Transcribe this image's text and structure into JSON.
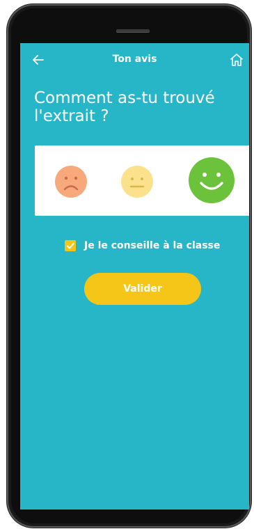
{
  "header": {
    "title": "Ton avis",
    "back_icon": "arrow-left-icon",
    "home_icon": "home-icon"
  },
  "question": "Comment as-tu trouvé l'extrait ?",
  "rating": {
    "options": [
      {
        "name": "sad",
        "icon": "sad-face-icon",
        "color": "#f7a97c",
        "selected": false
      },
      {
        "name": "neutral",
        "icon": "neutral-face-icon",
        "color": "#fbe18b",
        "selected": false
      },
      {
        "name": "happy",
        "icon": "happy-face-icon",
        "color": "#6cc23a",
        "selected": true
      }
    ]
  },
  "recommend": {
    "label": "Je le conseille à la classe",
    "checked": true
  },
  "submit": {
    "label": "Valider"
  },
  "colors": {
    "screen_bg": "#27b6c7",
    "accent": "#f5c518",
    "card_bg": "#ffffff"
  }
}
